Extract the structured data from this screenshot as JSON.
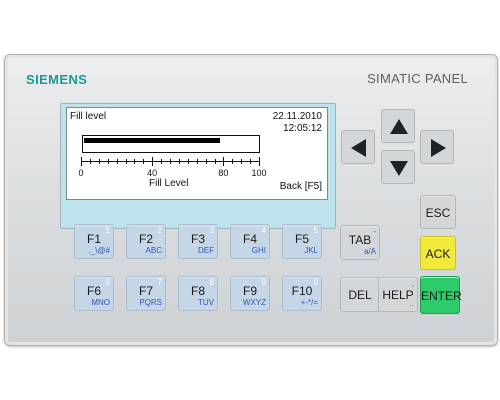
{
  "panel": {
    "brand": "SIEMENS",
    "model": "SIMATIC PANEL",
    "brand_color": "#1a9a95"
  },
  "screen": {
    "title": "Fill level",
    "date": "22.11.2010",
    "time": "12:05:12",
    "gauge_label": "Fill Level",
    "gauge_value_percent": 78,
    "scale_ticks": [
      "0",
      "40",
      "80",
      "100"
    ],
    "back_label": "Back [F5]"
  },
  "function_keys": [
    {
      "label": "F1",
      "num": "1",
      "sub": "._\\@#"
    },
    {
      "label": "F2",
      "num": "2",
      "sub": "ABC"
    },
    {
      "label": "F3",
      "num": "3",
      "sub": "DEF"
    },
    {
      "label": "F4",
      "num": "4",
      "sub": "GHI"
    },
    {
      "label": "F5",
      "num": "5",
      "sub": "JKL"
    },
    {
      "label": "F6",
      "num": "6",
      "sub": "MNO"
    },
    {
      "label": "F7",
      "num": "7",
      "sub": "PQRS"
    },
    {
      "label": "F8",
      "num": "8",
      "sub": "TUV"
    },
    {
      "label": "F9",
      "num": "9",
      "sub": "WXYZ"
    },
    {
      "label": "F10",
      "num": "0",
      "sub": "+-*/="
    }
  ],
  "control_keys": {
    "tab": {
      "label": "TAB",
      "sub": "a/A",
      "num": "-"
    },
    "del": {
      "label": "DEL"
    },
    "help": {
      "label": "HELP",
      "num": ",",
      "sub": ".."
    },
    "esc": {
      "label": "ESC"
    },
    "ack": {
      "label": "ACK"
    },
    "enter": {
      "label": "ENTER"
    }
  },
  "arrow_icons": [
    "arrow-up-icon",
    "arrow-left-icon",
    "arrow-right-icon",
    "arrow-down-icon"
  ],
  "colors": {
    "key_blue": "#c5d6e6",
    "ack_yellow": "#f1ea3a",
    "enter_green": "#2ecb6a",
    "screen_frame": "#bfe3ec"
  }
}
